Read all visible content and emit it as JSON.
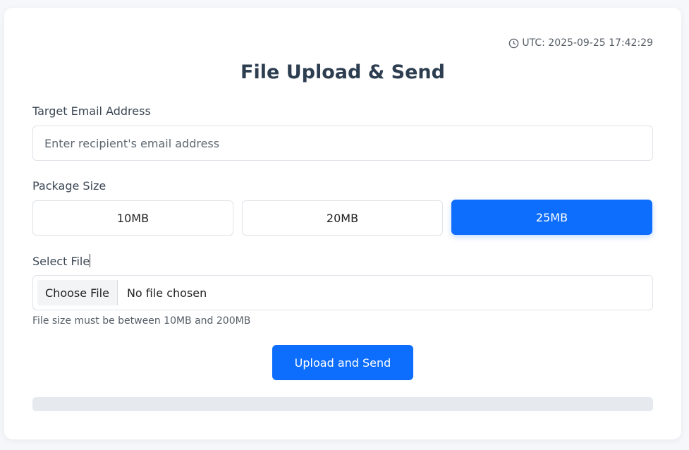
{
  "header": {
    "utc_label": "UTC: 2025-09-25 17:42:29",
    "title": "File Upload & Send"
  },
  "email": {
    "label": "Target Email Address",
    "placeholder": "Enter recipient's email address",
    "value": ""
  },
  "package": {
    "label": "Package Size",
    "options": [
      "10MB",
      "20MB",
      "25MB"
    ],
    "selected": "25MB"
  },
  "file": {
    "label": "Select File",
    "choose_label": "Choose File",
    "status": "No file chosen",
    "hint": "File size must be between 10MB and 200MB"
  },
  "actions": {
    "upload_label": "Upload and Send"
  },
  "progress": {
    "percent": 0
  },
  "colors": {
    "accent": "#0d6efd",
    "title": "#2c3e50",
    "progress_track": "#e6e9ed"
  },
  "icons": {
    "utc": "clock-icon"
  }
}
